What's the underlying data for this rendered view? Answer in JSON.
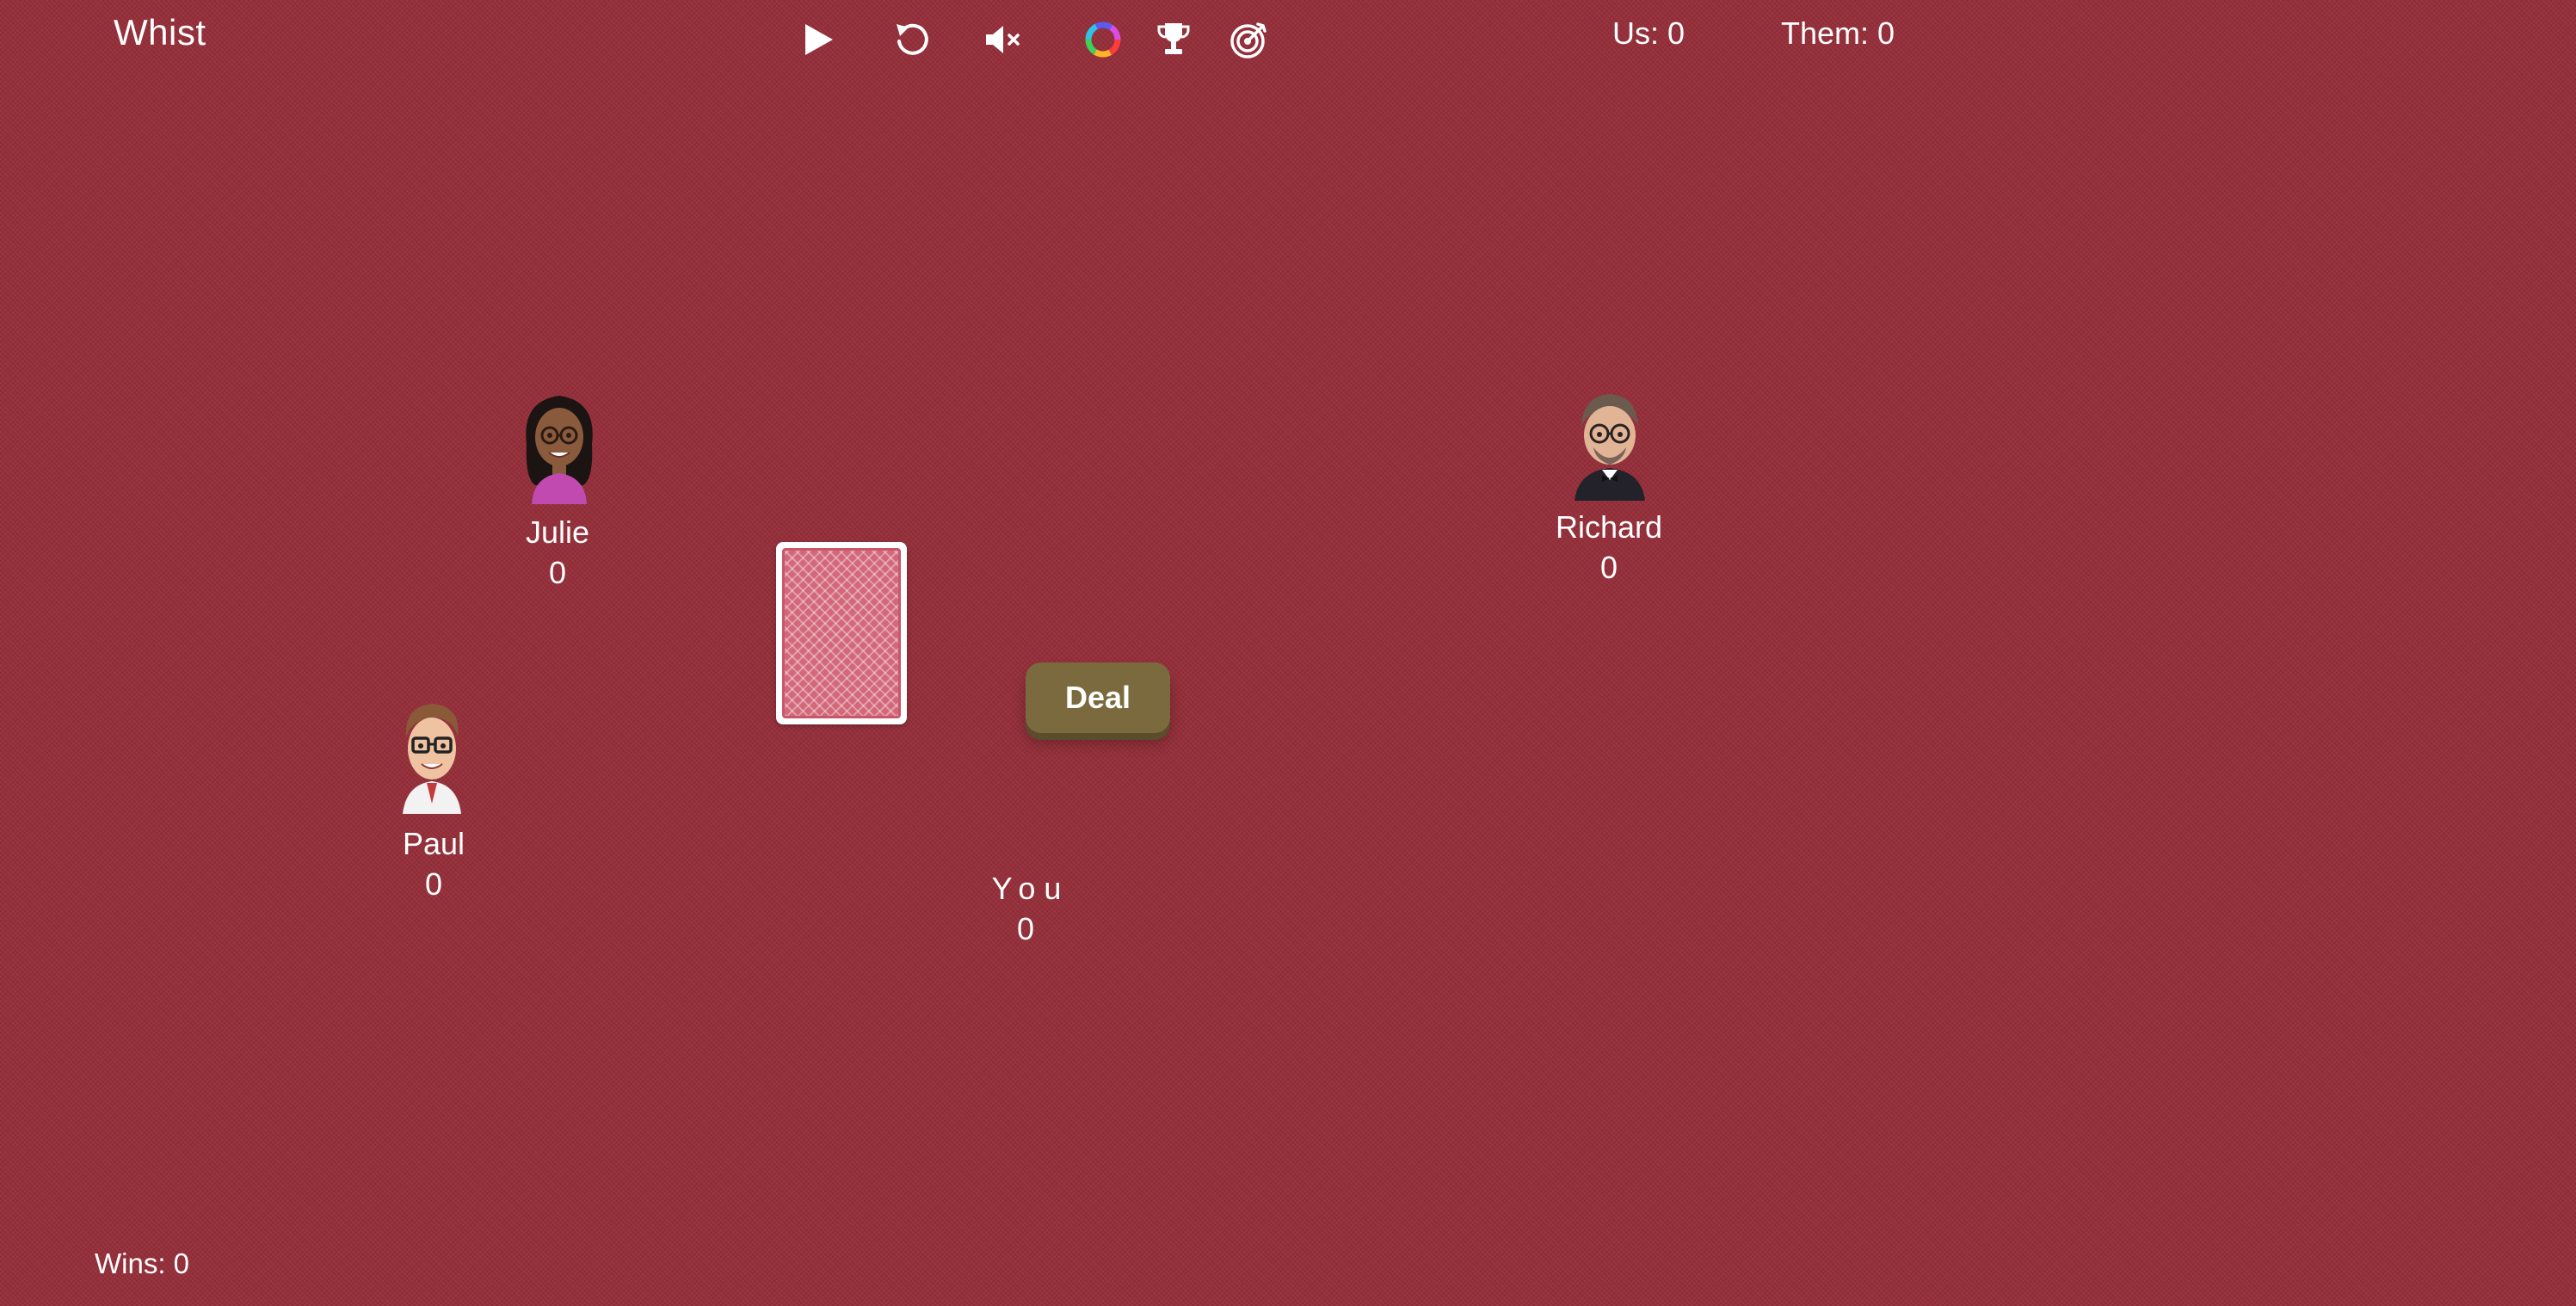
{
  "app": {
    "title": "Whist"
  },
  "toolbar": {
    "icons": [
      {
        "name": "play-icon",
        "label": "play"
      },
      {
        "name": "restart-icon",
        "label": "restart"
      },
      {
        "name": "sound-muted-icon",
        "label": "mute"
      },
      {
        "name": "color-wheel-icon",
        "label": "theme"
      },
      {
        "name": "trophy-icon",
        "label": "achievements"
      },
      {
        "name": "target-icon",
        "label": "goals"
      }
    ]
  },
  "scores": {
    "us": "Us: 0",
    "them": "Them: 0"
  },
  "players": {
    "julie": {
      "name": "Julie",
      "score": "0"
    },
    "richard": {
      "name": "Richard",
      "score": "0"
    },
    "paul": {
      "name": "Paul",
      "score": "0"
    },
    "you": {
      "name": "You",
      "score": "0"
    }
  },
  "controls": {
    "deal_label": "Deal"
  },
  "footer": {
    "wins": "Wins: 0"
  },
  "colors": {
    "table_felt": "#962f3a",
    "deal_button": "#7c6a3f",
    "card_back": "#d2687a",
    "text": "#ffffff"
  }
}
